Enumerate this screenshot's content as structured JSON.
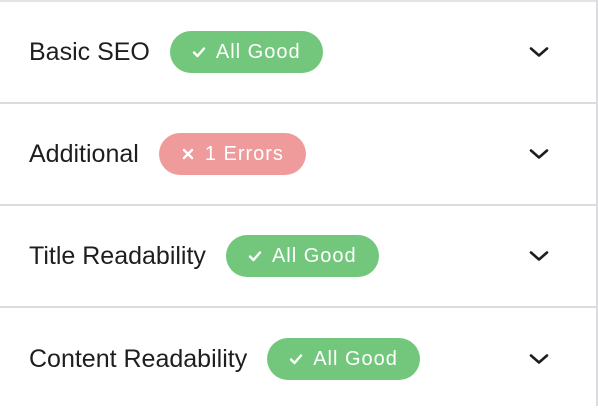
{
  "sections": [
    {
      "title": "Basic SEO",
      "badge_text": "All Good",
      "status": "good",
      "badge_icon": "check-icon",
      "toggle_icon": "chevron-down-icon"
    },
    {
      "title": "Additional",
      "badge_text": "1 Errors",
      "status": "error",
      "badge_icon": "close-icon",
      "toggle_icon": "chevron-down-icon"
    },
    {
      "title": "Title Readability",
      "badge_text": "All Good",
      "status": "good",
      "badge_icon": "check-icon",
      "toggle_icon": "chevron-down-icon"
    },
    {
      "title": "Content Readability",
      "badge_text": "All Good",
      "status": "good",
      "badge_icon": "check-icon",
      "toggle_icon": "chevron-down-icon"
    }
  ],
  "colors": {
    "good": "#72c77c",
    "error": "#ef9b9b",
    "text": "#1e1e1e",
    "divider": "#dcdcde"
  }
}
